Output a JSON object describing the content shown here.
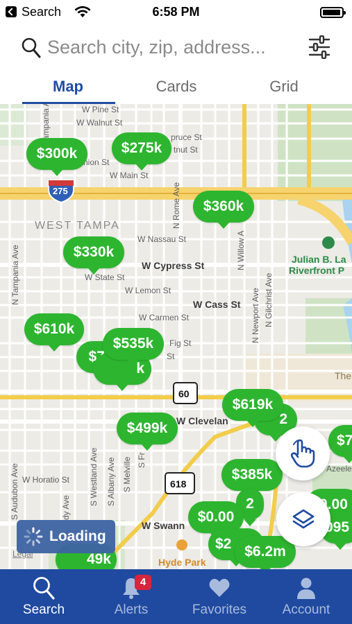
{
  "status_bar": {
    "back_label": "Search",
    "time": "6:58 PM"
  },
  "search": {
    "placeholder": "Search city, zip, address..."
  },
  "tabs": [
    {
      "label": "Map",
      "active": true
    },
    {
      "label": "Cards",
      "active": false
    },
    {
      "label": "Grid",
      "active": false
    }
  ],
  "map": {
    "area_labels": {
      "west_tampa": "WEST TAMPA",
      "julian_park_1": "Julian B. La",
      "julian_park_2": "Riverfront P",
      "hyde_park": "Hyde Park",
      "legal": "Legal",
      "the": "The"
    },
    "highway_shields": {
      "i275": "275",
      "fl60": "60",
      "fl618": "618"
    },
    "streets": {
      "pine": "W Pine St",
      "walnut": "W Walnut St",
      "spruce": "pruce St",
      "chestnut": "tnut St",
      "union": "nion St",
      "main": "W Main St",
      "nassau": "W Nassau St",
      "cypress": "W Cypress St",
      "state": "W State St",
      "lemon": "W Lemon St",
      "cass": "W Cass St",
      "carmen": "W Carmen St",
      "fig": "Fig St",
      "fig2": "St",
      "cleveland": "W Clevelan",
      "horatio": "W Horatio St",
      "swann": "W Swann",
      "azeele": "Azeele",
      "rome": "N Rome Ave",
      "willow": "N Willow A",
      "newport": "N Newport Ave",
      "gilchrist": "N Gilchrist Ave",
      "tampania_top": "N Tampania Ave",
      "tampania": "N Tampania Ave",
      "westland": "S Westland Ave",
      "albany": "S Albany Ave",
      "melville": "S Melville",
      "audubon": "S Audubon Ave",
      "fr": "S Fr",
      "dy": "dy Ave"
    },
    "markers": [
      {
        "id": "m300k",
        "label": "$300k"
      },
      {
        "id": "m275k",
        "label": "$275k"
      },
      {
        "id": "m360k",
        "label": "$360k"
      },
      {
        "id": "m330k",
        "label": "$330k"
      },
      {
        "id": "m610k",
        "label": "$610k"
      },
      {
        "id": "m79",
        "label": "$79"
      },
      {
        "id": "mk",
        "label": "k"
      },
      {
        "id": "m535k",
        "label": "$535k"
      },
      {
        "id": "m619k",
        "label": "$619k"
      },
      {
        "id": "m2a",
        "label": "2"
      },
      {
        "id": "m499k",
        "label": "$499k"
      },
      {
        "id": "m7",
        "label": "$7"
      },
      {
        "id": "m385k",
        "label": "$385k"
      },
      {
        "id": "m2b",
        "label": "2"
      },
      {
        "id": "m000a",
        "label": "$0.00"
      },
      {
        "id": "m000b",
        "label": "0.00"
      },
      {
        "id": "m095",
        "label": "095"
      },
      {
        "id": "m2c",
        "label": "$2"
      },
      {
        "id": "m62m",
        "label": "$6.2m"
      },
      {
        "id": "m49k",
        "label": "49k"
      }
    ],
    "loading_label": "Loading"
  },
  "bottom_nav": [
    {
      "label": "Search",
      "icon": "search-icon",
      "active": true
    },
    {
      "label": "Alerts",
      "icon": "bell-icon",
      "active": false,
      "badge": "4"
    },
    {
      "label": "Favorites",
      "icon": "heart-icon",
      "active": false
    },
    {
      "label": "Account",
      "icon": "person-icon",
      "active": false
    }
  ],
  "colors": {
    "brand_blue": "#1f4aa0",
    "tab_active": "#1f4da3",
    "marker_green": "#2db52f",
    "badge_red": "#d8253b"
  }
}
